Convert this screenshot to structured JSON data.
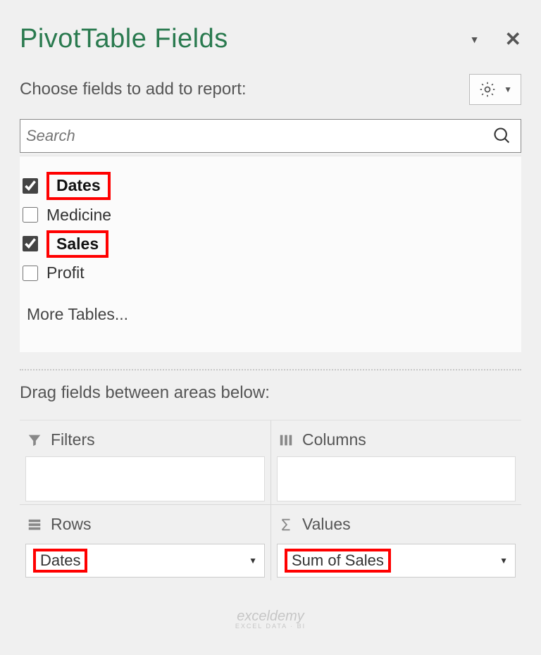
{
  "header": {
    "title": "PivotTable Fields"
  },
  "subhead": "Choose fields to add to report:",
  "search": {
    "placeholder": "Search"
  },
  "fields": [
    {
      "label": "Dates",
      "checked": true
    },
    {
      "label": "Medicine",
      "checked": false
    },
    {
      "label": "Sales",
      "checked": true
    },
    {
      "label": "Profit",
      "checked": false
    }
  ],
  "more_tables": "More Tables...",
  "drag_label": "Drag fields between areas below:",
  "areas": {
    "filters": {
      "label": "Filters"
    },
    "columns": {
      "label": "Columns"
    },
    "rows": {
      "label": "Rows",
      "item": "Dates"
    },
    "values": {
      "label": "Values",
      "item": "Sum of Sales"
    }
  },
  "watermark": {
    "brand": "exceldemy",
    "tag": "EXCEL DATA · BI"
  }
}
